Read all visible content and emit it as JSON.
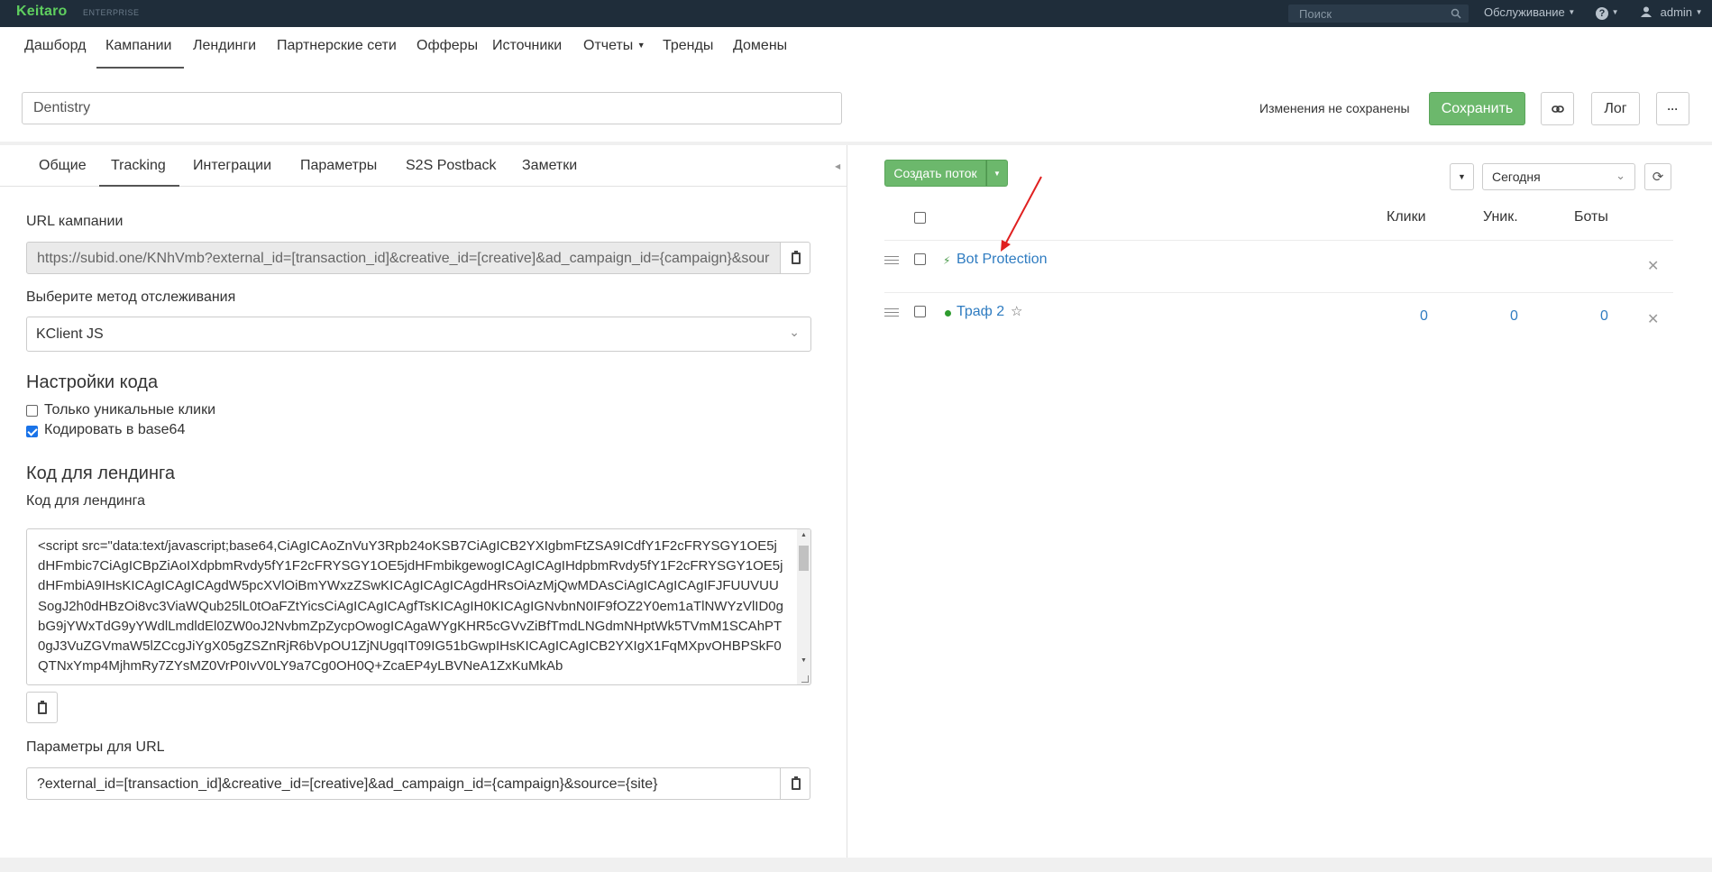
{
  "topbar": {
    "logo": "Keitaro",
    "edition": "ENTERPRISE",
    "search_placeholder": "Поиск",
    "service_menu": "Обслуживание",
    "help": "?",
    "user": "admin"
  },
  "nav": {
    "items": [
      "Дашборд",
      "Кампании",
      "Лендинги",
      "Партнерские сети",
      "Офферы",
      "Источники",
      "Отчеты",
      "Тренды",
      "Домены"
    ],
    "active": "Кампании"
  },
  "campaign": {
    "name": "Dentistry",
    "unsaved": "Изменения не сохранены",
    "save": "Сохранить",
    "log": "Лог",
    "more": "···"
  },
  "tabs": {
    "items": [
      "Общие",
      "Tracking",
      "Интеграции",
      "Параметры",
      "S2S Postback",
      "Заметки"
    ],
    "active": "Tracking"
  },
  "tracking": {
    "url_label": "URL кампании",
    "url_value": "https://subid.one/KNhVmb?external_id=[transaction_id]&creative_id=[creative]&ad_campaign_id={campaign}&sour",
    "method_label": "Выберите метод отслеживания",
    "method_value": "KClient JS",
    "code_settings_title": "Настройки кода",
    "unique_clicks_label": "Только уникальные клики",
    "unique_clicks_checked": false,
    "base64_label": "Кодировать в base64",
    "base64_checked": true,
    "landing_code_title": "Код для лендинга",
    "landing_code_label": "Код для лендинга",
    "landing_code_value": "<script src=\"data:text/javascript;base64,CiAgICAoZnVuY3Rpb24oKSB7CiAgICB2YXIgbmFtZSA9ICdfY1F2cFRYSGY1OE5jdHFmbic7CiAgICBpZiAoIXdpbmRvdy5fY1F2cFRYSGY1OE5jdHFmbikgewogICAgICAgIHdpbmRvdy5fY1F2cFRYSGY1OE5jdHFmbiA9IHsKICAgICAgICAgdW5pcXVlOiBmYWxzZSwKICAgICAgICAgdHRsOiAzMjQwMDAsCiAgICAgICAgIFJFUUVUUSogJ2h0dHBzOi8vc3ViaWQub25lL0tOaFZtYicsCiAgICAgICAgfTsKICAgIH0KICAgIGNvbnN0IF9fOZ2Y0em1aTlNWYzVlID0gbG9jYWxTdG9yYWdlLmdldEl0ZW0oJ2NvbmZpZycpOwogICAgaWYgKHR5cGVvZiBfTmdLNGdmNHptWk5TVmM1SCAhPT0gJ3VuZGVmaW5lZCcgJiYgX05gZSZnRjR6bVpOU1ZjNUgqIT09IG51bGwpIHsKICAgICAgICB2YXIgX1FqMXpvOHBPSkF0QTNxYmp4MjhmRy7ZYsMZ0VrP0IvV0LY9a7Cg0OH0Q+ZcaEP4yLBVNeA1ZxKuMkAb",
    "url_params_label": "Параметры для URL",
    "url_params_value": "?external_id=[transaction_id]&creative_id=[creative]&ad_campaign_id={campaign}&source={site}"
  },
  "flows": {
    "create_button": "Создать поток",
    "period": "Сегодня",
    "columns": [
      "Клики",
      "Уник.",
      "Боты"
    ],
    "rows": [
      {
        "name": "Bot Protection",
        "icon": "bolt-icon",
        "clicks": "",
        "unique": "",
        "bots": ""
      },
      {
        "name": "Траф 2",
        "icon": "status-dot-icon",
        "clicks": "0",
        "unique": "0",
        "bots": "0"
      }
    ]
  },
  "colors": {
    "topbar_bg": "#1f2d3a",
    "logo": "#5fcf5f",
    "save_button": "#6cb86c",
    "link": "#2f7cc1",
    "annotation_arrow": "#e02020"
  }
}
